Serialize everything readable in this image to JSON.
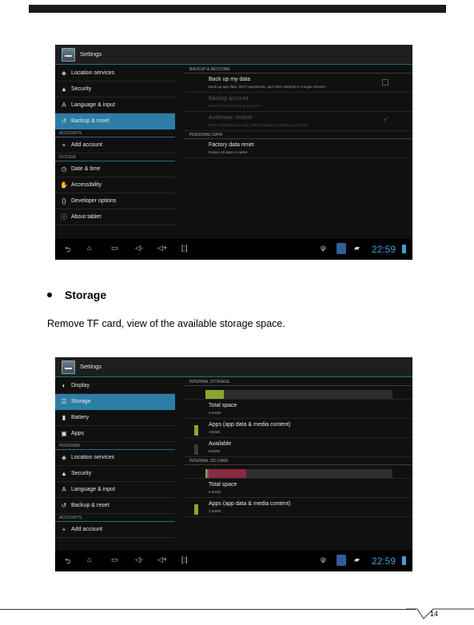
{
  "page_number": "14",
  "section": {
    "heading": "Storage",
    "description": "Remove TF card, view of the available storage space."
  },
  "screenshot1": {
    "app_title": "Settings",
    "left_items": [
      {
        "label": "Location services",
        "icon": "location-icon",
        "glyph": "◈"
      },
      {
        "label": "Security",
        "icon": "lock-icon",
        "glyph": "🔒"
      },
      {
        "label": "Language & input",
        "icon": "keyboard-a-icon",
        "glyph": "A"
      },
      {
        "label": "Backup & reset",
        "icon": "backup-icon",
        "glyph": "↺"
      }
    ],
    "accounts_header": "ACCOUNTS",
    "add_account": "Add account",
    "system_header": "SYSTEM",
    "system_items": [
      {
        "label": "Date & time",
        "icon": "clock-icon",
        "glyph": "◷"
      },
      {
        "label": "Accessibility",
        "icon": "hand-icon",
        "glyph": "✋"
      },
      {
        "label": "Developer options",
        "icon": "braces-icon",
        "glyph": "{}"
      },
      {
        "label": "About tablet",
        "icon": "info-icon",
        "glyph": "ⓘ"
      }
    ],
    "backup_header": "BACKUP & RESTORE",
    "backup_items": [
      {
        "title": "Back up my data",
        "subtitle": "Back up app data, Wi-Fi passwords, and other settings to Google servers."
      },
      {
        "title": "Backup account",
        "subtitle": "Need to set the backup account"
      },
      {
        "title": "Automatic restore",
        "subtitle": "When reinstalling an app, restore backed up settings and data"
      }
    ],
    "personal_header": "PERSONAL DATA",
    "factory_title": "Factory data reset",
    "factory_subtitle": "Erases all data on tablet",
    "clock": "22:59"
  },
  "screenshot2": {
    "app_title": "Settings",
    "left_items": [
      {
        "label": "Display",
        "icon": "display-icon",
        "glyph": "◐"
      },
      {
        "label": "Storage",
        "icon": "storage-icon",
        "glyph": "☰"
      },
      {
        "label": "Battery",
        "icon": "battery-icon",
        "glyph": "▮"
      },
      {
        "label": "Apps",
        "icon": "apps-icon",
        "glyph": "▣"
      }
    ],
    "personal_header": "PERSONAL",
    "personal_items": [
      {
        "label": "Location services",
        "icon": "location-icon",
        "glyph": "◈"
      },
      {
        "label": "Security",
        "icon": "lock-icon",
        "glyph": "🔒"
      },
      {
        "label": "Language & input",
        "icon": "keyboard-a-icon",
        "glyph": "A"
      },
      {
        "label": "Backup & reset",
        "icon": "backup-icon",
        "glyph": "↺"
      }
    ],
    "accounts_header": "ACCOUNTS",
    "add_account": "Add account",
    "internal_header": "INTERNAL STORAGE",
    "internal_used_fraction": 0.1,
    "internal_items": [
      {
        "title": "Total space",
        "value": "0.99GB"
      },
      {
        "title": "Apps (app data & media content)",
        "value": "106MB",
        "color": "#8aa62e"
      },
      {
        "title": "Available",
        "value": "893MB",
        "color": "#3a3a3a"
      }
    ],
    "sd_header": "INTERNAL SD CARD",
    "sd_segments": [
      {
        "color": "#8aa62e",
        "fraction": 0.01
      },
      {
        "color": "#6a5aa6",
        "fraction": 0.01
      },
      {
        "color": "#8a2a3e",
        "fraction": 0.2
      }
    ],
    "sd_items": [
      {
        "title": "Total space",
        "value": "5.88GB"
      },
      {
        "title": "Apps (app data & media content)",
        "value": "2.59MB",
        "color": "#8aa62e"
      }
    ],
    "clock": "22:59"
  }
}
